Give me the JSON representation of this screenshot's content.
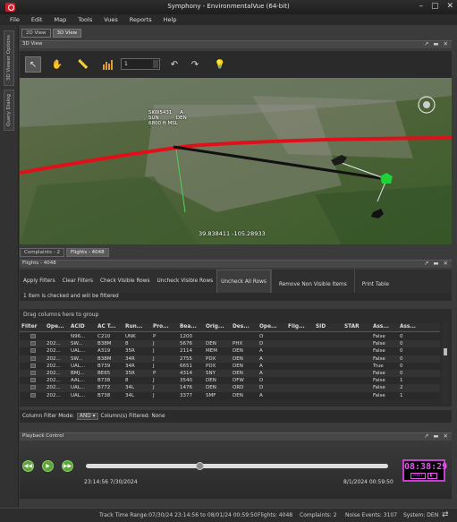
{
  "window": {
    "title": "Symphony - EnvironmentalVue (64-bit)",
    "min": "–",
    "max": "▢",
    "close": "✕"
  },
  "menu": [
    "File",
    "Edit",
    "Map",
    "Tools",
    "Vues",
    "Reports",
    "Help"
  ],
  "side_tabs": [
    "3D Viewer Options",
    "Query Dialog"
  ],
  "doc_tabs": [
    "2D View",
    "3D View"
  ],
  "view3d": {
    "title": "3D View",
    "speed_value": "1",
    "labels": {
      "flight": "SKW5431",
      "flight_code": "A",
      "origin": "SUN",
      "dest": "DEN",
      "altitude": "6800 ft MSL"
    },
    "coordinate": "39.838411  -105.28933"
  },
  "bottom_tabs": [
    "Complaints - 2",
    "Flights - 4048"
  ],
  "flights_panel": {
    "title": "Flights - 4048",
    "buttons": [
      "Apply Filters",
      "Clear Filters",
      "Check Visible Rows",
      "Uncheck Visible Rows",
      "Uncheck All Rows",
      "Remove Non Visible Items",
      "Print Table"
    ],
    "status": "1 item is checked and will be filtered",
    "group_hint": "Drag columns here to group",
    "columns": [
      "Filter",
      "Ope...",
      "ACID",
      "AC T...",
      "Run...",
      "Pro...",
      "Bea...",
      "Orig...",
      "Des...",
      "Ope...",
      "Flig...",
      "SID",
      "STAR",
      "Ass...",
      "Ass..."
    ],
    "rows": [
      [
        "",
        "",
        "N96...",
        "C210",
        "UNK",
        "P",
        "1200",
        "",
        "",
        "O",
        "",
        "",
        "",
        "False",
        "0"
      ],
      [
        "",
        "202...",
        "SW...",
        "B38M",
        "8",
        "J",
        "5676",
        "DEN",
        "PHX",
        "D",
        "",
        "",
        "",
        "False",
        "0"
      ],
      [
        "",
        "202...",
        "UAL...",
        "A319",
        "35R",
        "J",
        "2114",
        "MEM",
        "DEN",
        "A",
        "",
        "",
        "",
        "False",
        "0"
      ],
      [
        "",
        "202...",
        "SW...",
        "B38M",
        "34R",
        "J",
        "2755",
        "PDX",
        "DEN",
        "A",
        "",
        "",
        "",
        "False",
        "0"
      ],
      [
        "",
        "202...",
        "UAL...",
        "B739",
        "34R",
        "J",
        "6651",
        "PDX",
        "DEN",
        "A",
        "",
        "",
        "",
        "True",
        "0"
      ],
      [
        "",
        "202...",
        "BMJ...",
        "BE65",
        "35R",
        "P",
        "4314",
        "SNY",
        "DEN",
        "A",
        "",
        "",
        "",
        "False",
        "0"
      ],
      [
        "",
        "202...",
        "AAL...",
        "B738",
        "8",
        "J",
        "3540",
        "DEN",
        "DFW",
        "D",
        "",
        "",
        "",
        "False",
        "1"
      ],
      [
        "",
        "202...",
        "UAL...",
        "B772",
        "34L",
        "J",
        "1476",
        "DEN",
        "ORD",
        "D",
        "",
        "",
        "",
        "False",
        "2"
      ],
      [
        "",
        "202...",
        "UAL...",
        "B738",
        "34L",
        "J",
        "3377",
        "SMF",
        "DEN",
        "A",
        "",
        "",
        "",
        "False",
        "1"
      ]
    ],
    "filter_mode_label": "Column Filter Mode:",
    "filter_mode_value": "AND",
    "filtered_label": "Column(s) Filtered: None"
  },
  "playback": {
    "title": "Playback Control",
    "start": "23:14:56 7/30/2024",
    "end": "8/1/2024 00:59:50",
    "progress": 0.375,
    "clock": "08:38:29",
    "mode_a": "HIST",
    "mode_b": "▮◦"
  },
  "statusbar": {
    "track_range": "Track Time Range:07/30/24 23:14:56 to 08/01/24 00:59:50",
    "flights": "Flights: 4048",
    "complaints": "Complaints: 2",
    "noise": "Noise Events: 3107",
    "system": "System: DEN"
  },
  "colors": {
    "accent_clock": "#e35be8",
    "flight_track": "#e0101a",
    "play_green": "#5da53a"
  }
}
